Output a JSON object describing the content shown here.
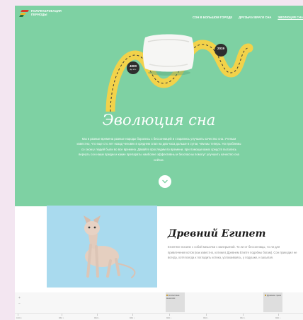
{
  "brand": {
    "line1": "ПОЛУФАБРИКАЦИЯ",
    "line2": "ПЕРИОДЫ"
  },
  "nav": [
    {
      "label": "СОН В БОЛЬШОМ ГОРОДЕ"
    },
    {
      "label": "ДРУЗЬЯ И ВРАГИ СНА"
    },
    {
      "label": "ЭВОЛЮЦИЯ СНА"
    }
  ],
  "hero": {
    "badge_left": {
      "value": "4000",
      "caption": "до н.э."
    },
    "badge_right": {
      "value": "2019"
    },
    "title": "Эволюция сна",
    "text": "Как в разные времена разные народы боролись с бессонницей и старались улучшить качество сна. Ученым известно, что еще сто лет назад человек в среднем спал на два часа дольше в сутки, чем мы теперь. Но проблемы со сном у людей были во все времена. Давайте проследим во времени, при помощи каких средств пытались вернуть сон наши предки и какие препараты наиболее эффективны и безопасны помогут улучшить качество сна сейчас."
  },
  "section": {
    "title": "Древний Египет",
    "text": "Египтяне носили с собой мешочки с валерьяной. То ли от бессонницы, то ли для привлечения котов (как известно, котики в Древнем Египте подобны богам). Сон приходил не всегда, хотя всегда к погладить котика, успокаиваясь, у подушки, и засыпая."
  },
  "timeline": {
    "controls": [
      "+",
      "−"
    ],
    "events": [
      {
        "label": "Египетские мешочки"
      },
      {
        "label": "Древние греки"
      }
    ],
    "ticks": [
      "0.00 г.",
      "960 г.",
      "960 г.",
      "960 г.",
      "960 г.",
      "960 г.",
      "960 г.",
      "960 г."
    ]
  }
}
